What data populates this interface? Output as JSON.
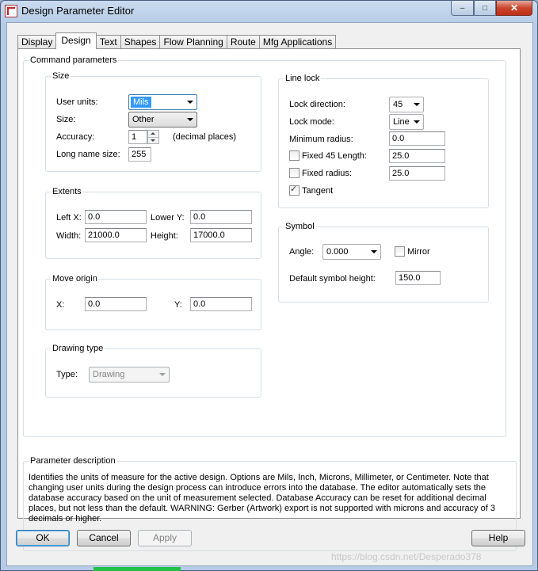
{
  "window": {
    "title": "Design Parameter Editor",
    "min": "–",
    "max": "□",
    "close": "✕"
  },
  "tabs": [
    {
      "label": "Display",
      "active": false
    },
    {
      "label": "Design",
      "active": true
    },
    {
      "label": "Text",
      "active": false
    },
    {
      "label": "Shapes",
      "active": false
    },
    {
      "label": "Flow Planning",
      "active": false
    },
    {
      "label": "Route",
      "active": false
    },
    {
      "label": "Mfg Applications",
      "active": false
    }
  ],
  "command_parameters": {
    "label": "Command parameters",
    "size": {
      "label": "Size",
      "user_units_label": "User units:",
      "user_units_value": "Mils",
      "size_label": "Size:",
      "size_value": "Other",
      "accuracy_label": "Accuracy:",
      "accuracy_value": "1",
      "accuracy_suffix": "(decimal places)",
      "long_name_label": "Long name size:",
      "long_name_value": "255"
    },
    "extents": {
      "label": "Extents",
      "left_x_label": "Left X:",
      "left_x_value": "0.0",
      "lower_y_label": "Lower Y:",
      "lower_y_value": "0.0",
      "width_label": "Width:",
      "width_value": "21000.0",
      "height_label": "Height:",
      "height_value": "17000.0"
    },
    "move_origin": {
      "label": "Move origin",
      "x_label": "X:",
      "x_value": "0.0",
      "y_label": "Y:",
      "y_value": "0.0"
    },
    "drawing_type": {
      "label": "Drawing type",
      "type_label": "Type:",
      "type_value": "Drawing"
    },
    "line_lock": {
      "label": "Line lock",
      "direction_label": "Lock direction:",
      "direction_value": "45",
      "mode_label": "Lock mode:",
      "mode_value": "Line",
      "min_radius_label": "Minimum radius:",
      "min_radius_value": "0.0",
      "fixed45_label": "Fixed 45 Length:",
      "fixed45_value": "25.0",
      "fixed45_checked": false,
      "fixed_radius_label": "Fixed radius:",
      "fixed_radius_value": "25.0",
      "fixed_radius_checked": false,
      "tangent_label": "Tangent",
      "tangent_checked": true
    },
    "symbol": {
      "label": "Symbol",
      "angle_label": "Angle:",
      "angle_value": "0.000",
      "mirror_label": "Mirror",
      "mirror_checked": false,
      "height_label": "Default symbol height:",
      "height_value": "150.0"
    }
  },
  "parameter_description": {
    "label": "Parameter description",
    "text": "Identifies the units of measure for the active design. Options are Mils, Inch, Microns, Millimeter, or Centimeter. Note that changing user units during the design process can introduce errors into the database.  The editor automatically sets the database accuracy based on the unit of measurement selected. Database Accuracy can be reset for additional decimal places, but not less than the default. WARNING: Gerber (Artwork) export is not supported with microns and accuracy of 3 decimals or higher."
  },
  "buttons": {
    "ok": "OK",
    "cancel": "Cancel",
    "apply": "Apply",
    "help": "Help"
  },
  "watermark": "https://blog.csdn.net/Desperado378"
}
